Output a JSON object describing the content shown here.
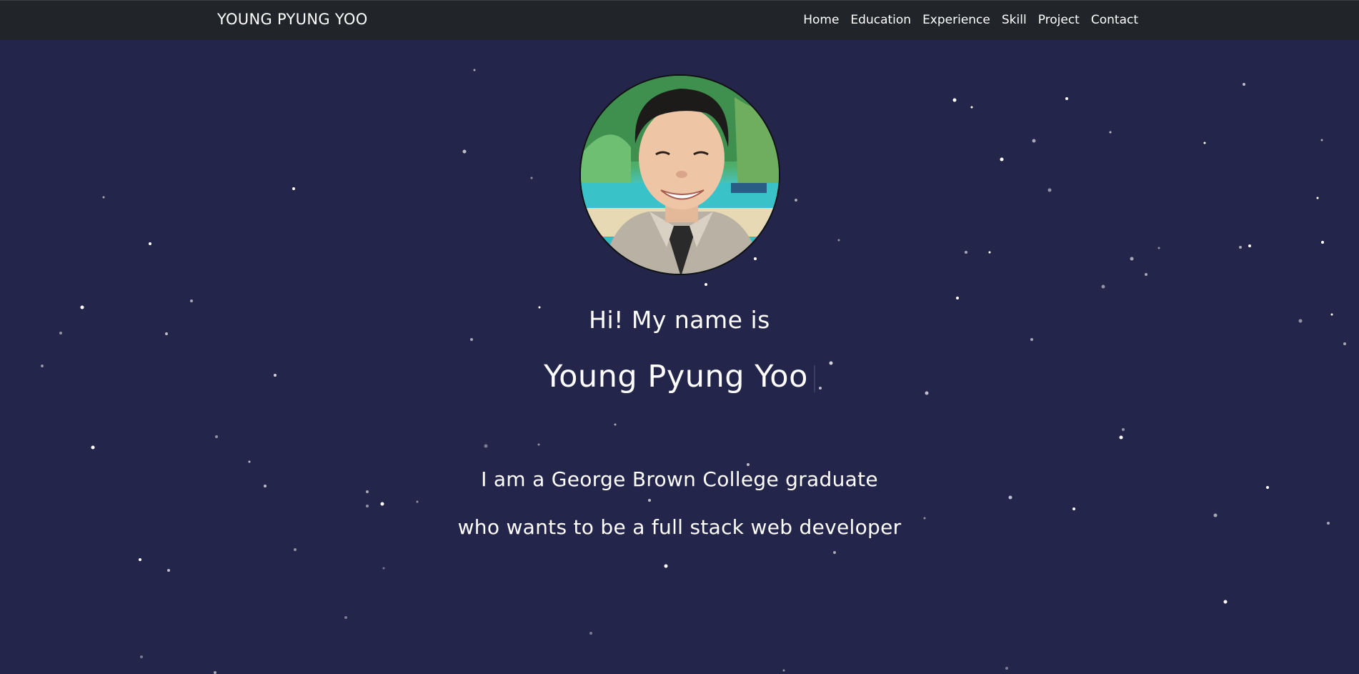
{
  "nav": {
    "brand": "YOUNG PYUNG YOO",
    "links": [
      "Home",
      "Education",
      "Experience",
      "Skill",
      "Project",
      "Contact"
    ]
  },
  "hero": {
    "greeting": "Hi! My name is",
    "name": "Young Pyung Yoo",
    "tagline_line1": "I am a George Brown College graduate",
    "tagline_line2": "who wants to be a full stack web developer"
  },
  "colors": {
    "background": "#23264a",
    "navbar": "#212529",
    "text": "#ffffff"
  },
  "icons": {
    "avatar": "profile-photo"
  }
}
